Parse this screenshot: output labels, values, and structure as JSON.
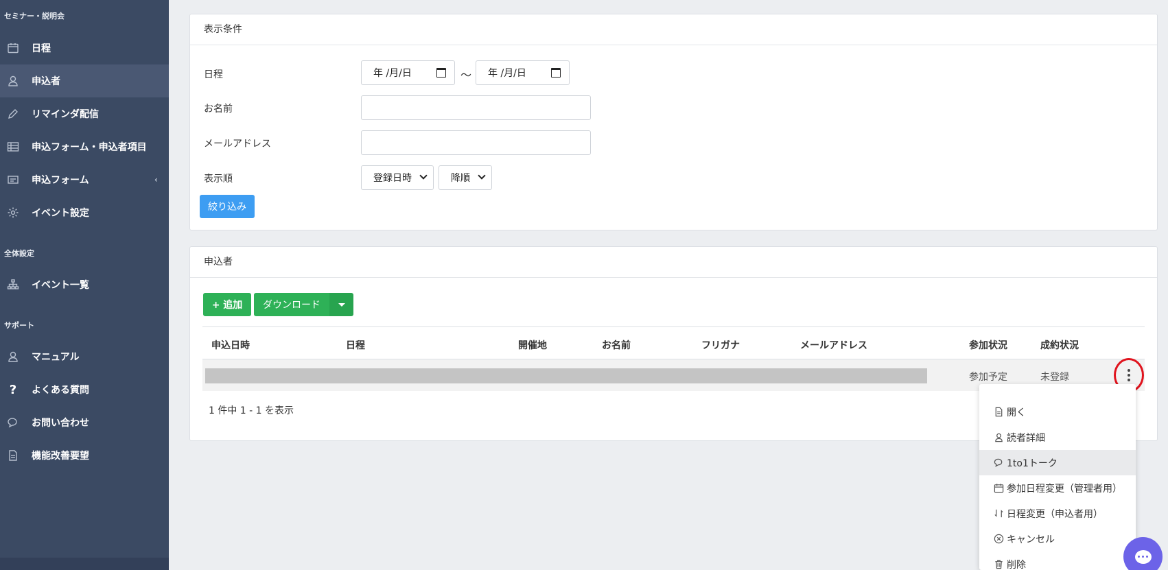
{
  "sidebar": {
    "section1": "セミナー・説明会",
    "items1": [
      {
        "label": "日程",
        "icon": "calendar-icon"
      },
      {
        "label": "申込者",
        "icon": "user-icon"
      },
      {
        "label": "リマインダ配信",
        "icon": "pencil-icon"
      },
      {
        "label": "申込フォーム・申込者項目",
        "icon": "table-icon"
      },
      {
        "label": "申込フォーム",
        "icon": "form-icon"
      },
      {
        "label": "イベント設定",
        "icon": "gear-icon"
      }
    ],
    "section2": "全体設定",
    "items2": [
      {
        "label": "イベント一覧",
        "icon": "sitemap-icon"
      }
    ],
    "section3": "サポート",
    "items3": [
      {
        "label": "マニュアル",
        "icon": "user-icon"
      },
      {
        "label": "よくある質問",
        "icon": "question-icon"
      },
      {
        "label": "お問い合わせ",
        "icon": "chat-icon"
      },
      {
        "label": "機能改善要望",
        "icon": "document-icon"
      }
    ]
  },
  "filter": {
    "title": "表示条件",
    "schedule_label": "日程",
    "date_from": "年 /月/日",
    "tilde": "〜",
    "date_to": "年 /月/日",
    "name_label": "お名前",
    "email_label": "メールアドレス",
    "order_label": "表示順",
    "sort_field": "登録日時",
    "sort_dir": "降順",
    "submit_label": "絞り込み"
  },
  "applicants": {
    "title": "申込者",
    "add_label": "+ 追加",
    "download_label": "ダウンロード",
    "columns": [
      "申込日時",
      "日程",
      "開催地",
      "お名前",
      "フリガナ",
      "メールアドレス",
      "参加状況",
      "成約状況"
    ],
    "row": {
      "status": "参加予定",
      "contract": "未登録"
    },
    "pagination": "1 件中 1 - 1 を表示"
  },
  "menu": {
    "items": [
      {
        "label": "開く",
        "icon": "file-icon"
      },
      {
        "label": "読者詳細",
        "icon": "user-icon"
      },
      {
        "label": "1to1トーク",
        "icon": "chat-icon"
      },
      {
        "label": "参加日程変更（管理者用）",
        "icon": "calendar-icon"
      },
      {
        "label": "日程変更（申込者用）",
        "icon": "swap-icon"
      },
      {
        "label": "キャンセル",
        "icon": "cancel-icon"
      },
      {
        "label": "削除",
        "icon": "trash-icon"
      }
    ]
  },
  "colors": {
    "sidebar": "#3b4a63",
    "primary": "#3d9df2",
    "success": "#2eb157",
    "highlight": "#e0141e",
    "chat": "#6c63e8"
  }
}
